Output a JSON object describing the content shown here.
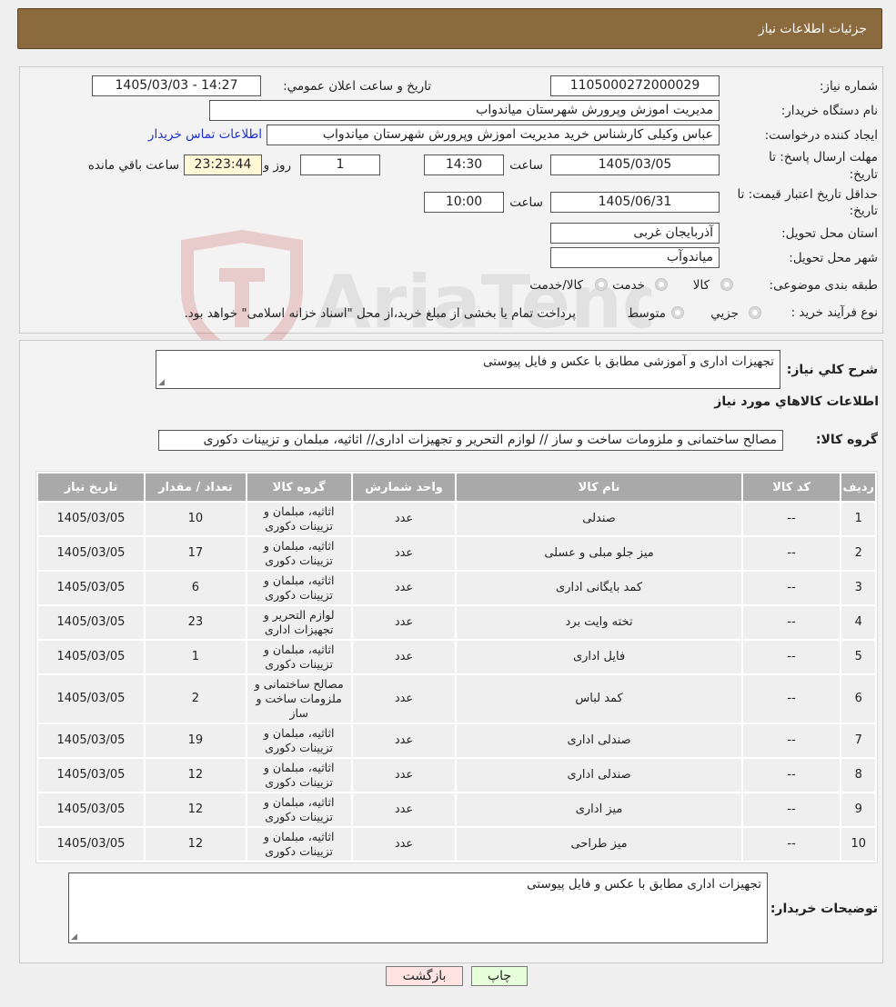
{
  "header": {
    "title": "جزئیات اطلاعات نیاز"
  },
  "watermark": {
    "text": "AriaTender.neT"
  },
  "info": {
    "need_number_label": "شماره نیاز:",
    "need_number": "1105000272000029",
    "announce_label": "تاریخ و ساعت اعلان عمومي:",
    "announce_value": "1405/03/03 - 14:27",
    "buyer_org_label": "نام دستگاه خریدار:",
    "buyer_org": "مدیریت اموزش وپرورش شهرستان میاندواب",
    "creator_label": "ایجاد کننده درخواست:",
    "creator": "عباس وکیلی کارشناس خرید مدیریت اموزش وپرورش شهرستان میاندواب",
    "contact_link": "اطلاعات تماس خریدار",
    "deadline_label_1": "مهلت ارسال پاسخ: تا",
    "deadline_label_2": "تاریخ:",
    "deadline_date": "1405/03/05",
    "hour_label": "ساعت",
    "deadline_time": "14:30",
    "days_value": "1",
    "days_label": "روز و",
    "remaining_time": "23:23:44",
    "remaining_label": "ساعت باقي مانده",
    "validity_label_1": "حداقل تاریخ اعتبار قیمت: تا",
    "validity_label_2": "تاریخ:",
    "validity_date": "1405/06/31",
    "validity_time": "10:00",
    "province_label": "استان محل تحویل:",
    "province": "آذربایجان غربی",
    "city_label": "شهر محل تحویل:",
    "city": "میاندوآب",
    "category_label": "طبقه بندی موضوعی:",
    "category_options": [
      "کالا",
      "خدمت",
      "کالا/خدمت"
    ],
    "process_label": "نوع فرآیند خرید :",
    "process_options": [
      "جزیي",
      "متوسط"
    ],
    "payment_note": "پرداخت تمام یا بخشی از مبلغ خرید،از محل \"اسناد خزانه اسلامی\" خواهد بود."
  },
  "details": {
    "summary_label": "شرح کلي نیاز:",
    "summary": "تجهیزات اداری و آموزشی مطابق با عکس و فایل پیوستی",
    "goods_section_title": "اطلاعات کالاهاي مورد نیاز",
    "goods_group_label": "گروه کالا:",
    "goods_group": "مصالح ساختمانی و ملزومات ساخت و ساز // لوازم التحریر و تجهیزات اداری// اثاثیه، مبلمان و تزیینات دکوری",
    "table": {
      "headers": [
        "ردیف",
        "کد کالا",
        "نام کالا",
        "واحد شمارش",
        "گروه کالا",
        "تعداد / مقدار",
        "تاریخ نیاز"
      ],
      "rows": [
        [
          "1",
          "--",
          "صندلی",
          "عدد",
          "اثاثیه، مبلمان و تزیینات دکوری",
          "10",
          "1405/03/05"
        ],
        [
          "2",
          "--",
          "میز جلو مبلی و عسلی",
          "عدد",
          "اثاثیه، مبلمان و تزیینات دکوری",
          "17",
          "1405/03/05"
        ],
        [
          "3",
          "--",
          "کمد بایگانی اداری",
          "عدد",
          "اثاثیه، مبلمان و تزیینات دکوری",
          "6",
          "1405/03/05"
        ],
        [
          "4",
          "--",
          "تخته وایت برد",
          "عدد",
          "لوازم التحریر و تجهیزات اداری",
          "23",
          "1405/03/05"
        ],
        [
          "5",
          "--",
          "فایل اداری",
          "عدد",
          "اثاثیه، مبلمان و تزیینات دکوری",
          "1",
          "1405/03/05"
        ],
        [
          "6",
          "--",
          "کمد لباس",
          "عدد",
          "مصالح ساختمانی و ملزومات ساخت و ساز",
          "2",
          "1405/03/05"
        ],
        [
          "7",
          "--",
          "صندلی اداری",
          "عدد",
          "اثاثیه، مبلمان و تزیینات دکوری",
          "19",
          "1405/03/05"
        ],
        [
          "8",
          "--",
          "صندلی اداری",
          "عدد",
          "اثاثیه، مبلمان و تزیینات دکوری",
          "12",
          "1405/03/05"
        ],
        [
          "9",
          "--",
          "میز اداری",
          "عدد",
          "اثاثیه، مبلمان و تزیینات دکوری",
          "12",
          "1405/03/05"
        ],
        [
          "10",
          "--",
          "میز طراحی",
          "عدد",
          "اثاثیه، مبلمان و تزیینات دکوری",
          "12",
          "1405/03/05"
        ]
      ]
    },
    "buyer_notes_label": "توضیحات خریدار:",
    "buyer_notes": "تجهیزات اداری مطابق با عکس و فایل پیوستی"
  },
  "buttons": {
    "print": "چاپ",
    "back": "بازگشت"
  },
  "colors": {
    "header": "#8b6b3d",
    "table_header": "#a9a9a9",
    "back_button": "#ffe2e2",
    "print_button": "#e8ffdc"
  }
}
